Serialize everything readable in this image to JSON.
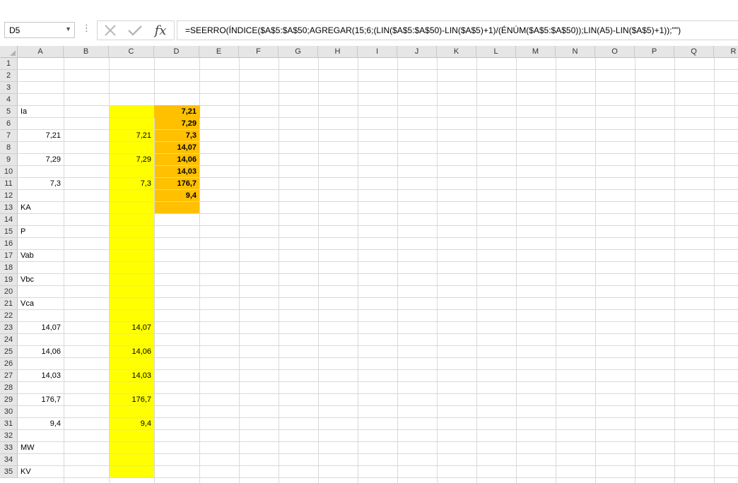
{
  "formula_bar": {
    "name_box": "D5",
    "more_glyph": "⋮",
    "fx_label": "fx",
    "formula": "=SEERRO(ÍNDICE($A$5:$A$50;AGREGAR(15;6;(LIN($A$5:$A$50)-LIN($A$5)+1)/(ÉNÚM($A$5:$A$50));LIN(A5)-LIN($A$5)+1));\"\")"
  },
  "columns": [
    "A",
    "B",
    "C",
    "D",
    "E",
    "F",
    "G",
    "H",
    "I",
    "J",
    "K",
    "L",
    "M",
    "N",
    "O",
    "P",
    "Q",
    "R"
  ],
  "rows": [
    "1",
    "2",
    "3",
    "4",
    "5",
    "6",
    "7",
    "8",
    "9",
    "10",
    "11",
    "12",
    "13",
    "14",
    "15",
    "16",
    "17",
    "18",
    "19",
    "20",
    "21",
    "22",
    "23",
    "24",
    "25",
    "26",
    "27",
    "28",
    "29",
    "30",
    "31",
    "32",
    "33",
    "34",
    "35"
  ],
  "cells": {
    "A5": "Ia",
    "A7": "7,21",
    "A9": "7,29",
    "A11": "7,3",
    "A13": "KA",
    "A15": "P",
    "A17": "Vab",
    "A19": "Vbc",
    "A21": "Vca",
    "A23": "14,07",
    "A25": "14,06",
    "A27": "14,03",
    "A29": "176,7",
    "A31": "9,4",
    "A33": "MW",
    "A35": "KV",
    "C7": "7,21",
    "C9": "7,29",
    "C11": "7,3",
    "C23": "14,07",
    "C25": "14,06",
    "C27": "14,03",
    "C29": "176,7",
    "C31": "9,4",
    "D5": "7,21",
    "D6": "7,29",
    "D7": "7,3",
    "D8": "14,07",
    "D9": "14,06",
    "D10": "14,03",
    "D11": "176,7",
    "D12": "9,4"
  },
  "colors": {
    "yellow_fill": "#ffff00",
    "orange_fill": "#ffc000",
    "header_bg": "#e6e6e6",
    "gridline": "#d9d9d9"
  },
  "highlights": {
    "yellow_range": "C5:C35",
    "orange_range": "D5:D13"
  }
}
